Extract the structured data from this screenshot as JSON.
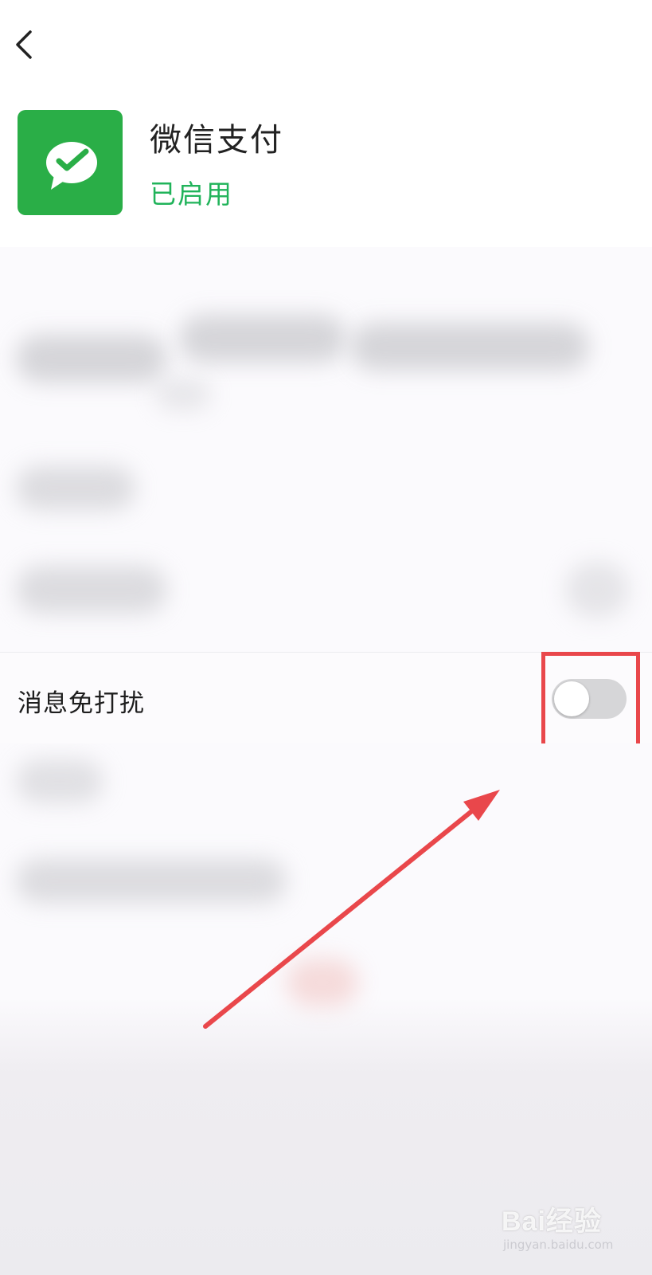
{
  "header": {
    "back_icon": "chevron-left-icon",
    "app_icon": "wechat-pay-icon",
    "app_name": "微信支付",
    "app_status": "已启用"
  },
  "settings": {
    "dnd_label": "消息免打扰",
    "dnd_enabled": false
  },
  "annotation": {
    "highlight_color": "#e9474b"
  },
  "watermark": {
    "logo": "Bai经验",
    "url": "jingyan.baidu.com"
  },
  "colors": {
    "brand_green": "#2aae47",
    "status_green": "#20b35a",
    "toggle_off": "#d6d6d8"
  }
}
